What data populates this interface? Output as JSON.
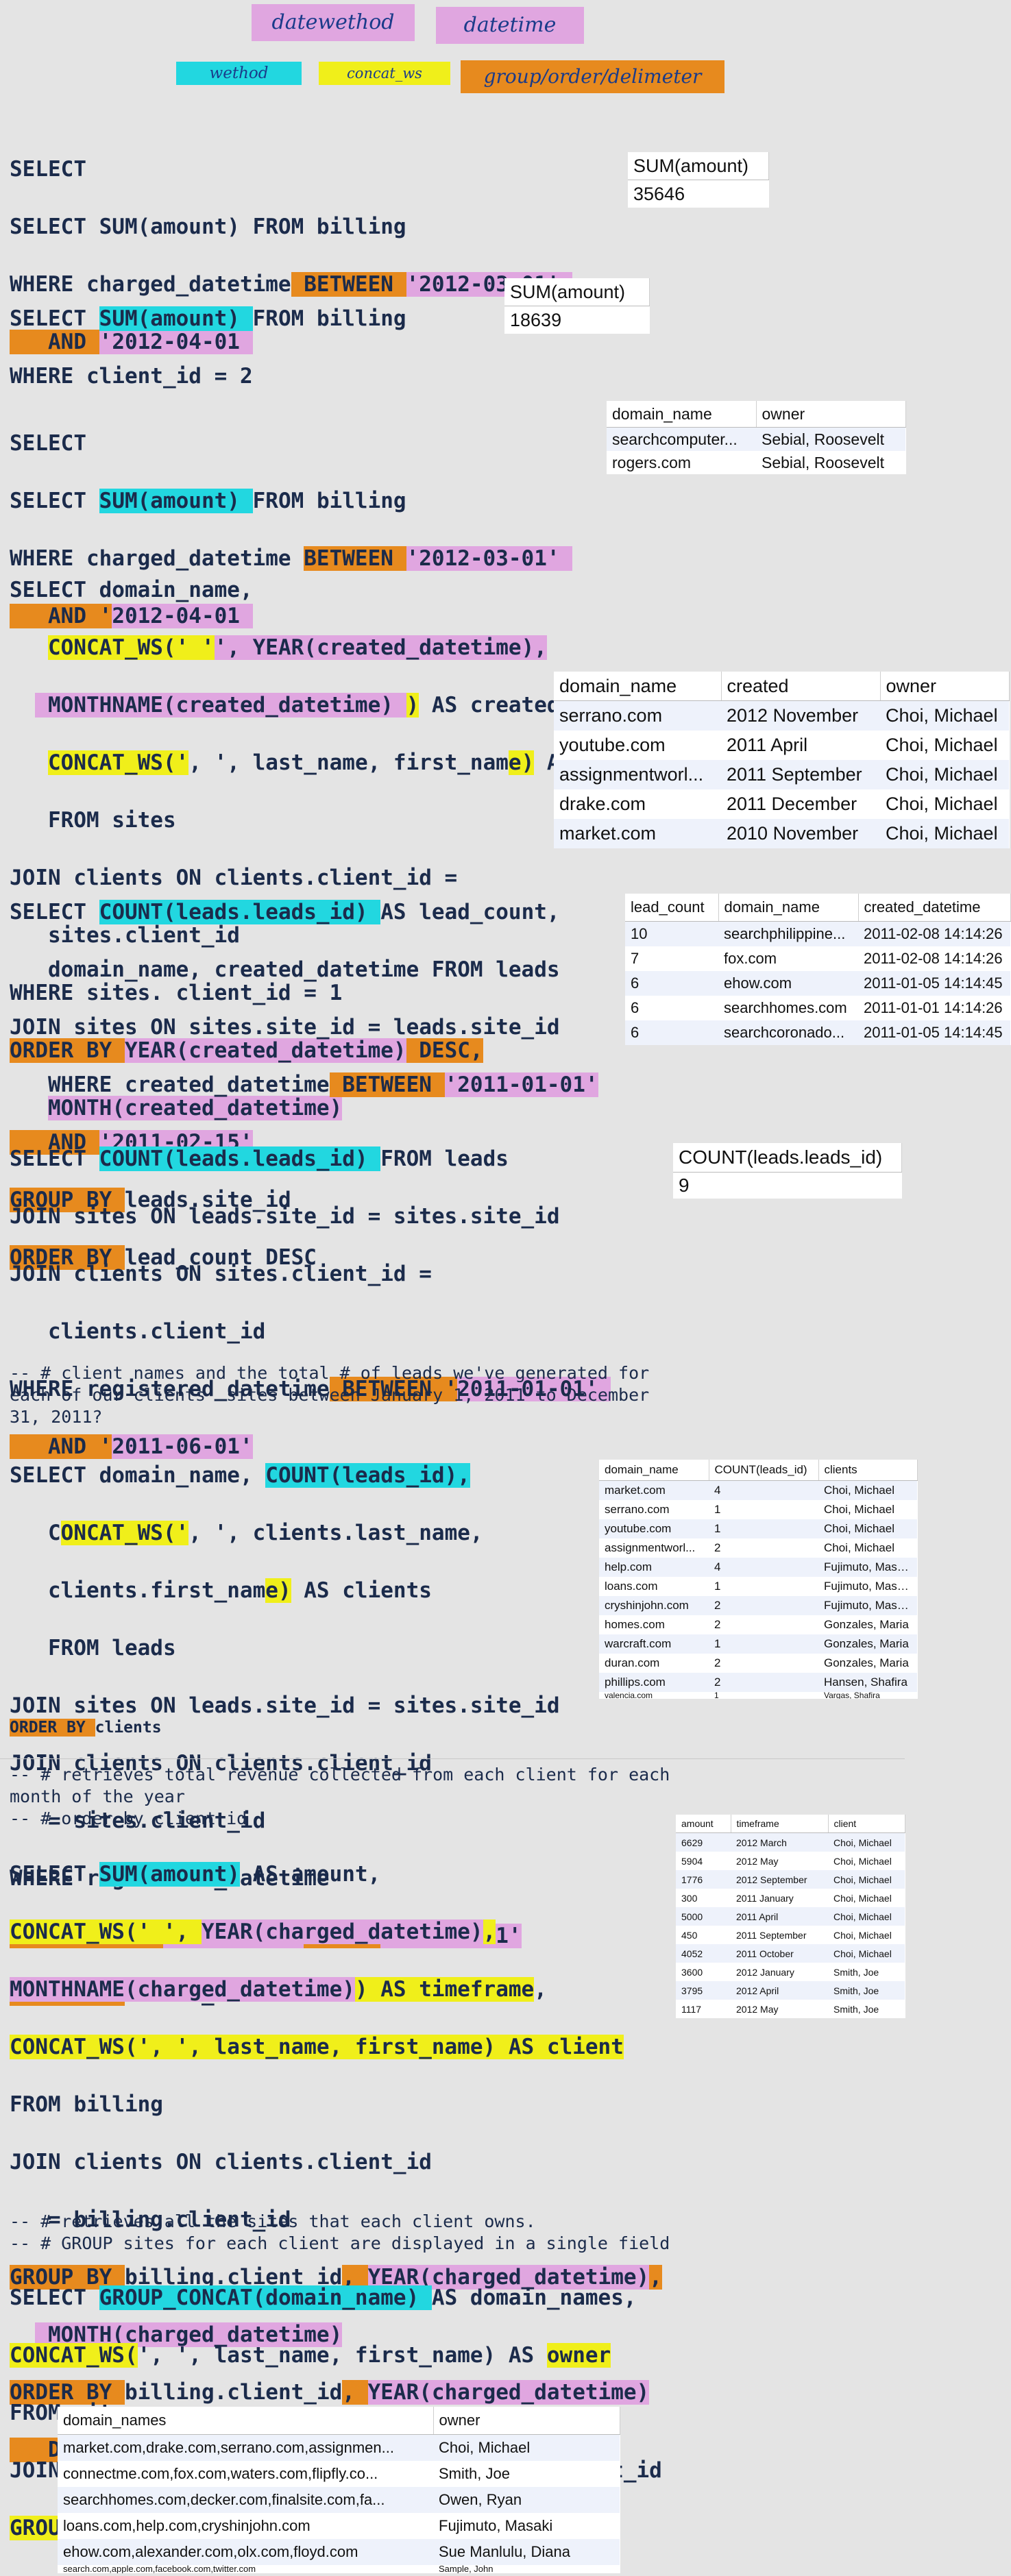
{
  "legend": {
    "top": [
      {
        "label": "datewethod",
        "color": "#e0a6e0"
      },
      {
        "label": "datetime",
        "color": "#e0a6e0"
      }
    ],
    "bottom": [
      {
        "label": "wethod",
        "color": "#22d7e0"
      },
      {
        "label": "concat_ws",
        "color": "#f0ef1a"
      },
      {
        "label": "group/order/delimeter",
        "color": "#e78a1e"
      }
    ]
  },
  "comments": {
    "c1": "-- # client names and the total # of leads we've generated for\neach of our clients' sites between January 1, 2011 to December\n31, 2011?",
    "c2": "-- # retrieves total revenue collected from each client for each\nmonth of the year\n-- # order by client id",
    "c3": "-- # retrieves all the sites that each client owns.\n-- # GROUP sites for each client are displayed in a single field"
  },
  "tables": {
    "t1": {
      "headers": [
        "SUM(amount)"
      ],
      "rows": [
        [
          "35646"
        ]
      ]
    },
    "t2": {
      "headers": [
        "SUM(amount)"
      ],
      "rows": [
        [
          "18639"
        ]
      ]
    },
    "t3": {
      "headers": [
        "domain_name",
        "owner"
      ],
      "rows": [
        [
          "searchcomputer...",
          "Sebial, Roosevelt"
        ],
        [
          "rogers.com",
          "Sebial, Roosevelt"
        ]
      ]
    },
    "t4": {
      "headers": [
        "domain_name",
        "created",
        "owner"
      ],
      "rows": [
        [
          "serrano.com",
          "2012 November",
          "Choi, Michael"
        ],
        [
          "youtube.com",
          "2011 April",
          "Choi, Michael"
        ],
        [
          "assignmentworl...",
          "2011 September",
          "Choi, Michael"
        ],
        [
          "drake.com",
          "2011 December",
          "Choi, Michael"
        ],
        [
          "market.com",
          "2010 November",
          "Choi, Michael"
        ]
      ]
    },
    "t5": {
      "headers": [
        "lead_count",
        "domain_name",
        "created_datetime"
      ],
      "rows": [
        [
          "10",
          "searchphilippine...",
          "2011-02-08 14:14:26"
        ],
        [
          "7",
          "fox.com",
          "2011-02-08 14:14:26"
        ],
        [
          "6",
          "ehow.com",
          "2011-01-05 14:14:45"
        ],
        [
          "6",
          "searchhomes.com",
          "2011-01-01 14:14:26"
        ],
        [
          "6",
          "searchcoronado...",
          "2011-01-05 14:14:45"
        ]
      ]
    },
    "t6": {
      "headers": [
        "COUNT(leads.leads_id)"
      ],
      "rows": [
        [
          "9"
        ]
      ]
    },
    "t7": {
      "headers": [
        "domain_name",
        "COUNT(leads_id)",
        "clients"
      ],
      "rows": [
        [
          "market.com",
          "4",
          "Choi, Michael"
        ],
        [
          "serrano.com",
          "1",
          "Choi, Michael"
        ],
        [
          "youtube.com",
          "1",
          "Choi, Michael"
        ],
        [
          "assignmentworl...",
          "2",
          "Choi, Michael"
        ],
        [
          "help.com",
          "4",
          "Fujimuto, Masaki"
        ],
        [
          "loans.com",
          "1",
          "Fujimuto, Masaki"
        ],
        [
          "cryshinjohn.com",
          "2",
          "Fujimuto, Masaki"
        ],
        [
          "homes.com",
          "2",
          "Gonzales, Maria"
        ],
        [
          "warcraft.com",
          "1",
          "Gonzales, Maria"
        ],
        [
          "duran.com",
          "2",
          "Gonzales, Maria"
        ],
        [
          "phillips.com",
          "2",
          "Hansen, Shafira"
        ],
        [
          "valencia.com",
          "1",
          "Vargas, Shafira"
        ]
      ]
    },
    "t8": {
      "headers": [
        "amount",
        "timeframe",
        "client"
      ],
      "rows": [
        [
          "6629",
          "2012 March",
          "Choi, Michael"
        ],
        [
          "5904",
          "2012 May",
          "Choi, Michael"
        ],
        [
          "1776",
          "2012 September",
          "Choi, Michael"
        ],
        [
          "300",
          "2011 January",
          "Choi, Michael"
        ],
        [
          "5000",
          "2011 April",
          "Choi, Michael"
        ],
        [
          "450",
          "2011 September",
          "Choi, Michael"
        ],
        [
          "4052",
          "2011 October",
          "Choi, Michael"
        ],
        [
          "3600",
          "2012 January",
          "Smith, Joe"
        ],
        [
          "3795",
          "2012 April",
          "Smith, Joe"
        ],
        [
          "1117",
          "2012 May",
          "Smith, Joe"
        ]
      ]
    },
    "t9": {
      "headers": [
        "domain_names",
        "owner"
      ],
      "rows": [
        [
          "market.com,drake.com,serrano.com,assignmen...",
          "Choi, Michael"
        ],
        [
          "connectme.com,fox.com,waters.com,flipfly.co...",
          "Smith, Joe"
        ],
        [
          "searchhomes.com,decker.com,finalsite.com,fa...",
          "Owen, Ryan"
        ],
        [
          "loans.com,help.com,cryshinjohn.com",
          "Fujimuto, Masaki"
        ],
        [
          "ehow.com,alexander.com,olx.com,floyd.com",
          "Sue Manlulu, Diana"
        ],
        [
          "search.com,apple.com,facebook.com,twitter.com",
          "Sample, John"
        ]
      ]
    }
  }
}
